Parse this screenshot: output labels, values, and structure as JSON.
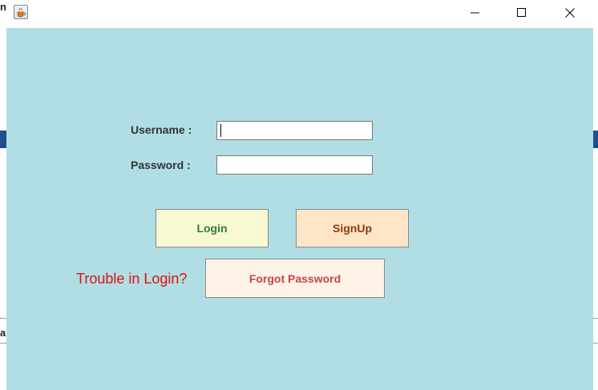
{
  "background_app": {
    "fragment_top": "n",
    "fragment_mid": "a"
  },
  "window": {
    "title": "",
    "icon": "java-cup-icon",
    "controls": {
      "minimize": "minimize-icon",
      "maximize": "maximize-icon",
      "close": "close-icon"
    }
  },
  "form": {
    "username_label": "Username :",
    "password_label": "Password :",
    "username_value": "",
    "password_value": "",
    "login_button": "Login",
    "signup_button": "SignUp",
    "trouble_text": "Trouble in Login?",
    "forgot_button": "Forgot Password"
  },
  "colors": {
    "panel_background": "#b0dee4",
    "login_bg": "#f8f8d2",
    "login_text": "#2e7d3a",
    "signup_bg": "#ffe5c8",
    "signup_text": "#8a3a0c",
    "forgot_bg": "#fdf3e6",
    "forgot_text": "#c5454a",
    "trouble_text": "#dd1111"
  }
}
